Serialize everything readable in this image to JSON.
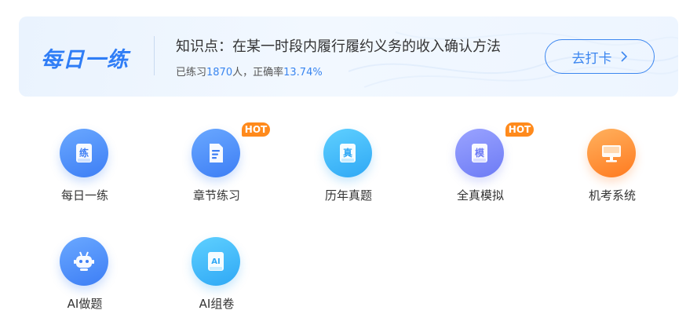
{
  "banner": {
    "brand": "每日一练",
    "topic": "知识点：在某一时段内履行履约义务的收入确认方法",
    "stats_prefix": "已练习",
    "stats_count": "1870",
    "stats_mid": "人，正确率",
    "stats_rate": "13.74%",
    "checkin_label": "去打卡"
  },
  "tiles": [
    {
      "label": "每日一练",
      "glyph": "练",
      "icon": "practice-book-icon",
      "badge": ""
    },
    {
      "label": "章节练习",
      "glyph": "",
      "icon": "document-icon",
      "badge": "HOT"
    },
    {
      "label": "历年真题",
      "glyph": "真",
      "icon": "past-papers-icon",
      "badge": ""
    },
    {
      "label": "全真模拟",
      "glyph": "模",
      "icon": "mock-exam-icon",
      "badge": "HOT"
    },
    {
      "label": "机考系统",
      "glyph": "",
      "icon": "computer-icon",
      "badge": ""
    },
    {
      "label": "AI做题",
      "glyph": "",
      "icon": "robot-icon",
      "badge": ""
    },
    {
      "label": "AI组卷",
      "glyph": "AI",
      "icon": "ai-paper-icon",
      "badge": ""
    }
  ],
  "colors": {
    "accent": "#3b86f0",
    "hot": "#ff8a1c",
    "blue_gradient": [
      "#6aa8ff",
      "#3d7ef5"
    ],
    "cyan_gradient": [
      "#5fd0ff",
      "#2fa8f5"
    ],
    "purple_gradient": [
      "#9aa3ff",
      "#6d7bf5"
    ],
    "orange_gradient": [
      "#ffb15e",
      "#ff7a1f"
    ]
  }
}
